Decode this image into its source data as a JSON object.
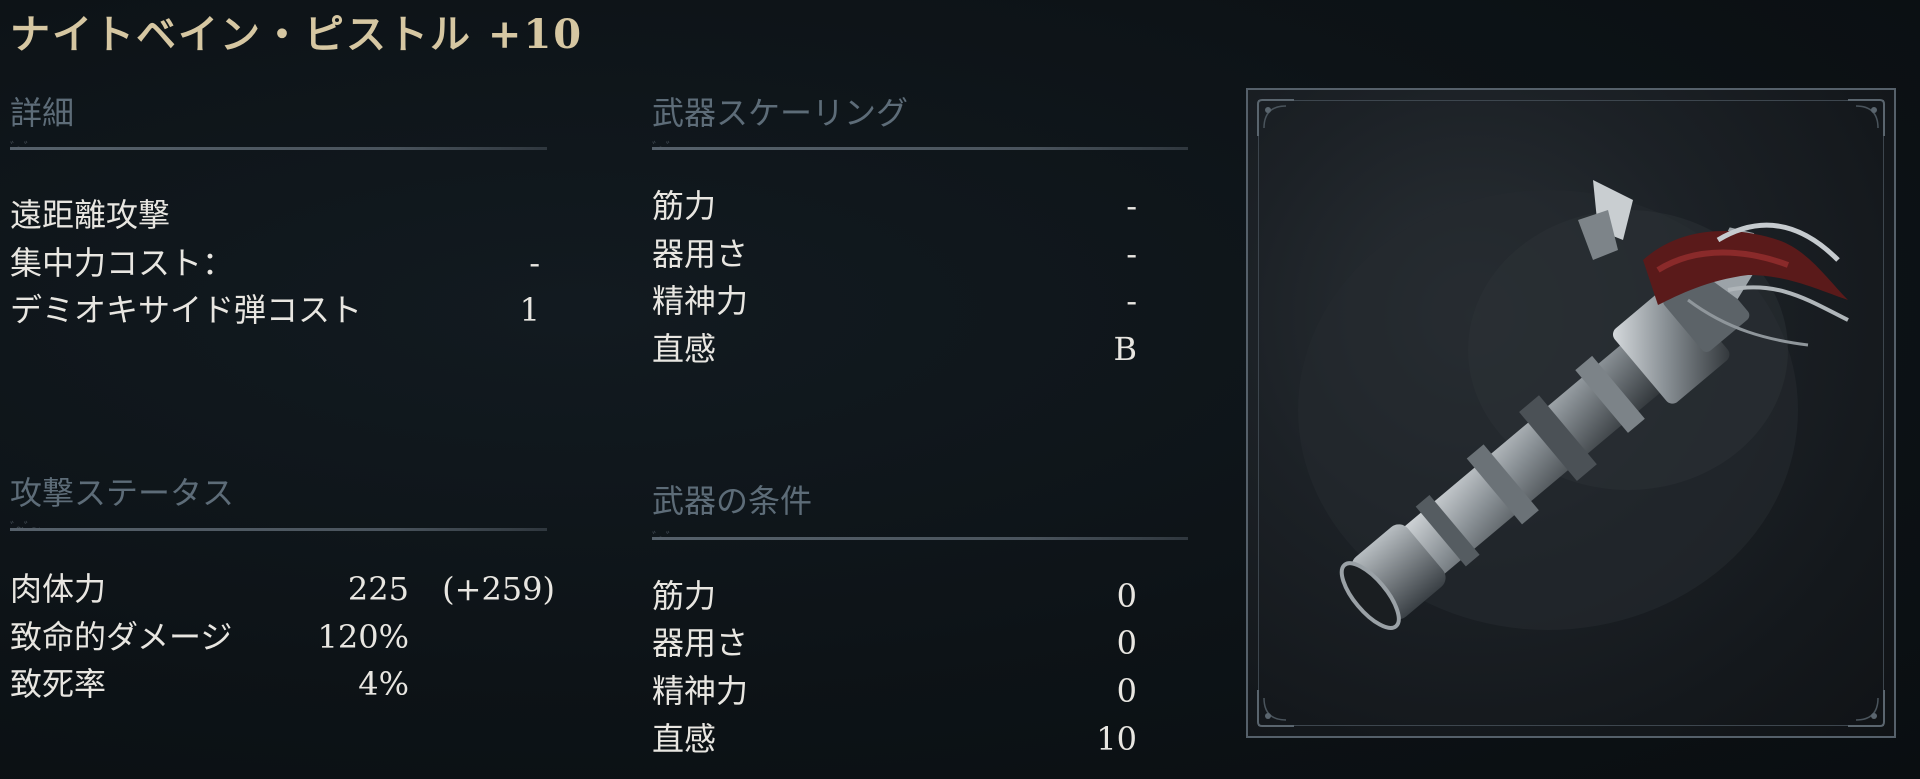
{
  "title": "ナイトベイン・ピストル +10",
  "details": {
    "heading": "詳細",
    "ornament": "ﾞ~ﾞ~",
    "rows": [
      {
        "label": "遠距離攻撃",
        "value": ""
      },
      {
        "label": "集中力コスト：",
        "value": "-"
      },
      {
        "label": "デミオキサイド弾コスト",
        "value": "1"
      }
    ]
  },
  "attack": {
    "heading": "攻撃ステータス",
    "ornament": "ﾞ~ﾞ~",
    "rows": [
      {
        "label": "肉体力",
        "value": "225",
        "bonus": "(+259)"
      },
      {
        "label": "致命的ダメージ",
        "value": "120%",
        "bonus": ""
      },
      {
        "label": "致死率",
        "value": "4%",
        "bonus": ""
      }
    ]
  },
  "scaling": {
    "heading": "武器スケーリング",
    "ornament": "ﾞ~ﾞ~",
    "rows": [
      {
        "label": "筋力",
        "value": "-"
      },
      {
        "label": "器用さ",
        "value": "-"
      },
      {
        "label": "精神力",
        "value": "-"
      },
      {
        "label": "直感",
        "value": "B"
      }
    ]
  },
  "requirements": {
    "heading": "武器の条件",
    "ornament": "ﾞ~ﾞ~",
    "rows": [
      {
        "label": "筋力",
        "value": "0"
      },
      {
        "label": "器用さ",
        "value": "0"
      },
      {
        "label": "精神力",
        "value": "0"
      },
      {
        "label": "直感",
        "value": "10"
      }
    ]
  },
  "image": {
    "icon": "nightbane-pistol-icon"
  },
  "colors": {
    "title": "#d6c7a2",
    "heading": "#5d6c78",
    "text": "#e8e6e1",
    "background": "#0d1216"
  }
}
